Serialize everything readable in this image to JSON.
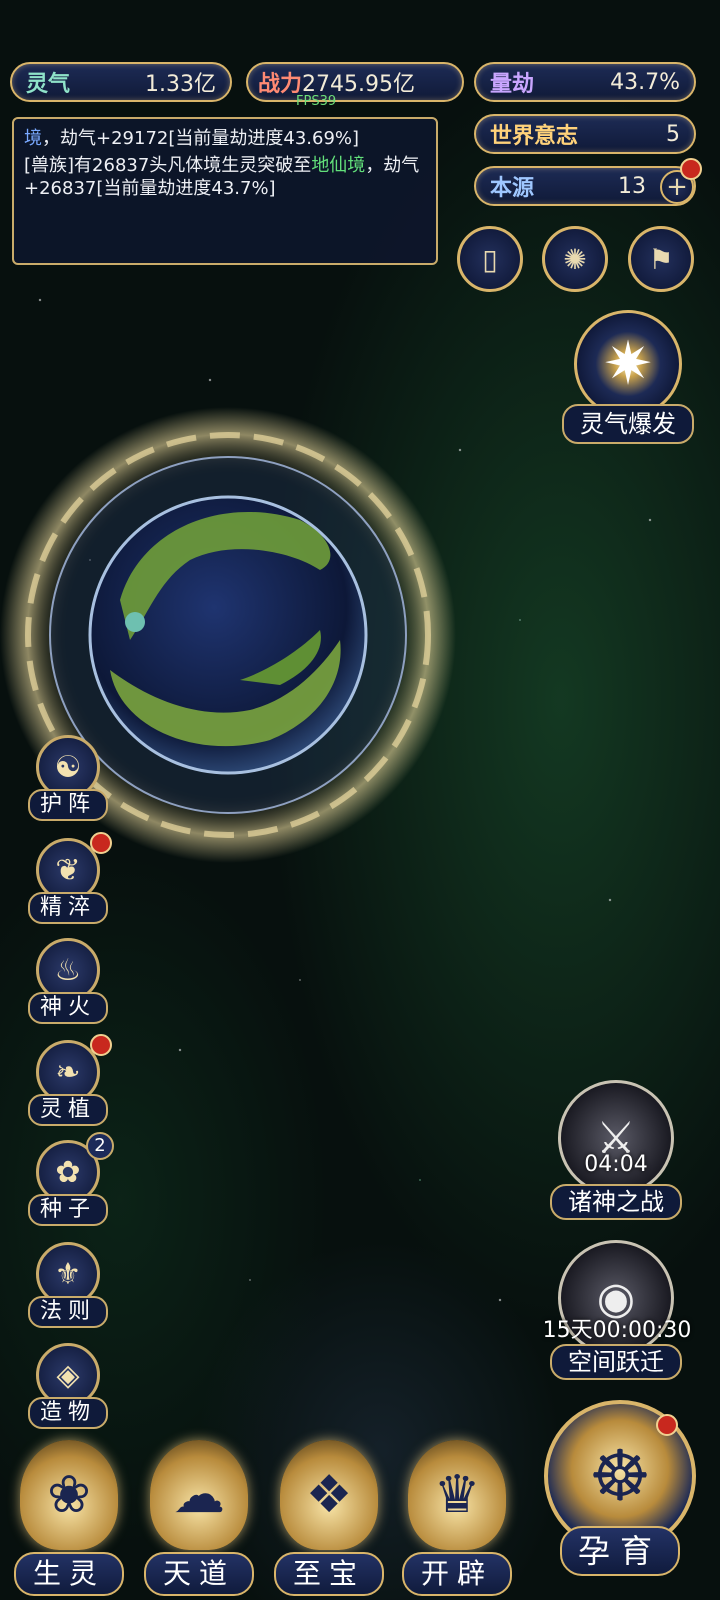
{
  "resources": {
    "lingqi_label": "灵气",
    "lingqi_value": "1.33亿",
    "zhanli_label": "战力",
    "zhanli_value": "2745.95亿",
    "liangjie_label": "量劫",
    "liangjie_value": "43.7%",
    "world_label": "世界意志",
    "world_value": "5",
    "source_label": "本源",
    "source_value": "13"
  },
  "fps": "FPS39",
  "log": {
    "line1_prefix": "境",
    "line1_rest": "，劫气+29172[当前量劫进度43.69%]",
    "line2_a": "[兽族]有26837头凡体境生灵突破至",
    "line2_hl": "地仙境",
    "line2_b": "，劫气+26837[当前量劫进度43.7%]"
  },
  "right_buttons": {
    "burst_label": "灵气爆发"
  },
  "side_menu": [
    {
      "label": "护阵"
    },
    {
      "label": "精淬"
    },
    {
      "label": "神火"
    },
    {
      "label": "灵植"
    },
    {
      "label": "种子",
      "badge": "2"
    },
    {
      "label": "法则"
    },
    {
      "label": "造物"
    }
  ],
  "events": {
    "war_timer": "04:04",
    "war_label": "诸神之战",
    "leap_timer": "15天00:00:30",
    "leap_label": "空间跃迁"
  },
  "bottom_nav": [
    {
      "label": "生灵"
    },
    {
      "label": "天道"
    },
    {
      "label": "至宝"
    },
    {
      "label": "开辟"
    },
    {
      "label": "孕育"
    }
  ],
  "colors": {
    "gold": "#d9b56a",
    "panel": "#101a38",
    "alert": "#c8281e"
  }
}
